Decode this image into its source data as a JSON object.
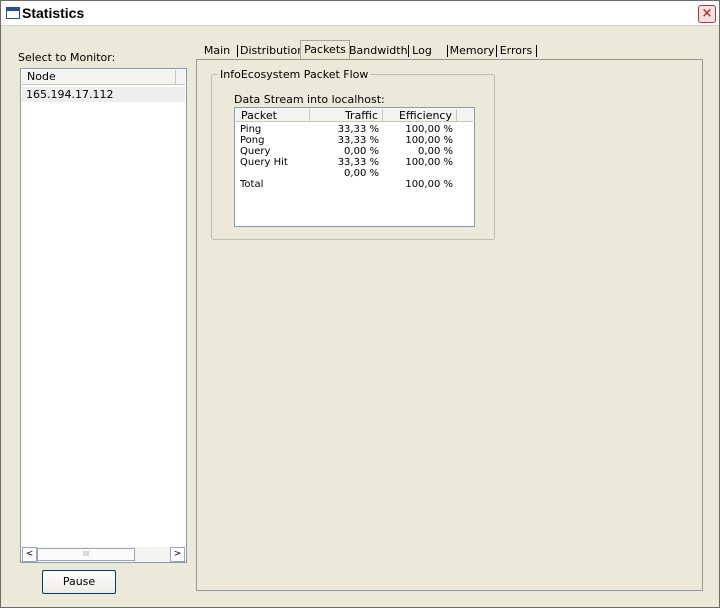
{
  "window": {
    "title": "Statistics",
    "close_glyph": "×"
  },
  "left_panel": {
    "label": "Select to Monitor:",
    "column_header": "Node",
    "nodes": [
      "165.194.17.112"
    ],
    "scroll_thumb_glyph": "III",
    "scroll_left_glyph": "<",
    "scroll_right_glyph": ">"
  },
  "pause_button": {
    "label": "Pause"
  },
  "tabs": [
    "Main",
    "Distribution",
    "Packets",
    "Bandwidth",
    "Log",
    "Memory",
    "Errors"
  ],
  "active_tab": "Packets",
  "packets_panel": {
    "group_title": "InfoEcosystem Packet Flow",
    "stream_label": "Data Stream into localhost:",
    "columns": [
      "Packet",
      "Traffic",
      "Efficiency"
    ],
    "rows": [
      [
        "Ping",
        "33,33 %",
        "100,00 %"
      ],
      [
        "Pong",
        "33,33 %",
        "100,00 %"
      ],
      [
        "Query",
        "0,00 %",
        "0,00 %"
      ],
      [
        "Query Hit",
        "33,33 %",
        "100,00 %"
      ],
      [
        "",
        "0,00 %",
        ""
      ],
      [
        "Total",
        "",
        "100,00 %"
      ]
    ]
  }
}
